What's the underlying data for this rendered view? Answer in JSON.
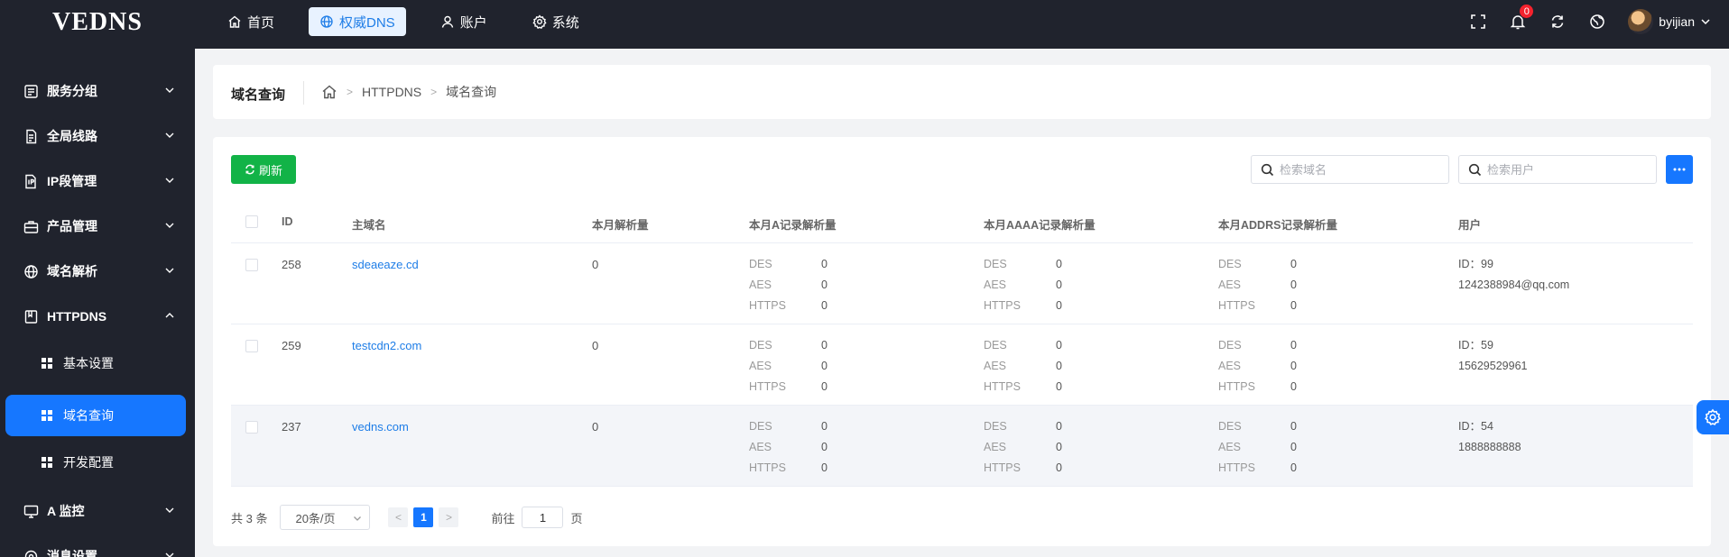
{
  "app": {
    "logo": "VEDNS"
  },
  "topnav": [
    {
      "label": "首页",
      "icon": "home-icon"
    },
    {
      "label": "权威DNS",
      "icon": "globe-icon",
      "active": true
    },
    {
      "label": "账户",
      "icon": "user-icon"
    },
    {
      "label": "系统",
      "icon": "gear-icon"
    }
  ],
  "toolbar": {
    "notification_count": "0",
    "username": "byijian"
  },
  "sidebar": {
    "items": [
      {
        "label": "服务分组",
        "icon": "server-icon"
      },
      {
        "label": "全局线路",
        "icon": "document-icon"
      },
      {
        "label": "IP段管理",
        "icon": "ip-icon"
      },
      {
        "label": "产品管理",
        "icon": "briefcase-icon"
      },
      {
        "label": "域名解析",
        "icon": "globe-icon"
      },
      {
        "label": "HTTPDNS",
        "icon": "bookmark-icon",
        "expanded": true
      },
      {
        "label": "A 监控",
        "icon": "monitor-icon"
      },
      {
        "label": "消息设置",
        "icon": "settings-icon"
      }
    ],
    "sub_items": [
      {
        "label": "基本设置"
      },
      {
        "label": "域名查询",
        "active": true
      },
      {
        "label": "开发配置"
      }
    ]
  },
  "header": {
    "title": "域名查询",
    "breadcrumb": [
      "HTTPDNS",
      "域名查询"
    ]
  },
  "main": {
    "refresh_label": "刷新",
    "search_domain_placeholder": "检索域名",
    "search_user_placeholder": "检索用户",
    "table": {
      "headers": {
        "id": "ID",
        "domain": "主域名",
        "monthly": "本月解析量",
        "a": "本月A记录解析量",
        "aaaa": "本月AAAA记录解析量",
        "addrs": "本月ADDRS记录解析量",
        "user": "用户"
      },
      "rows": [
        {
          "id": "258",
          "domain": "sdeaeaze.cd",
          "monthly": "0",
          "a": [
            [
              "DES",
              "0"
            ],
            [
              "AES",
              "0"
            ],
            [
              "HTTPS",
              "0"
            ]
          ],
          "aaaa": [
            [
              "DES",
              "0"
            ],
            [
              "AES",
              "0"
            ],
            [
              "HTTPS",
              "0"
            ]
          ],
          "addrs": [
            [
              "DES",
              "0"
            ],
            [
              "AES",
              "0"
            ],
            [
              "HTTPS",
              "0"
            ]
          ],
          "user_id": "ID：99",
          "user_name": "1242388984@qq.com"
        },
        {
          "id": "259",
          "domain": "testcdn2.com",
          "monthly": "0",
          "a": [
            [
              "DES",
              "0"
            ],
            [
              "AES",
              "0"
            ],
            [
              "HTTPS",
              "0"
            ]
          ],
          "aaaa": [
            [
              "DES",
              "0"
            ],
            [
              "AES",
              "0"
            ],
            [
              "HTTPS",
              "0"
            ]
          ],
          "addrs": [
            [
              "DES",
              "0"
            ],
            [
              "AES",
              "0"
            ],
            [
              "HTTPS",
              "0"
            ]
          ],
          "user_id": "ID：59",
          "user_name": "15629529961"
        },
        {
          "id": "237",
          "domain": "vedns.com",
          "monthly": "0",
          "a": [
            [
              "DES",
              "0"
            ],
            [
              "AES",
              "0"
            ],
            [
              "HTTPS",
              "0"
            ]
          ],
          "aaaa": [
            [
              "DES",
              "0"
            ],
            [
              "AES",
              "0"
            ],
            [
              "HTTPS",
              "0"
            ]
          ],
          "addrs": [
            [
              "DES",
              "0"
            ],
            [
              "AES",
              "0"
            ],
            [
              "HTTPS",
              "0"
            ]
          ],
          "user_id": "ID：54",
          "user_name": "1888888888"
        }
      ]
    },
    "pagination": {
      "total": "共 3 条",
      "page_size": "20条/页",
      "current_page": "1",
      "goto_prefix": "前往",
      "goto_value": "1",
      "goto_suffix": "页"
    }
  },
  "colors": {
    "primary": "#1677ff",
    "success": "#12b347",
    "dark": "#20232d"
  }
}
